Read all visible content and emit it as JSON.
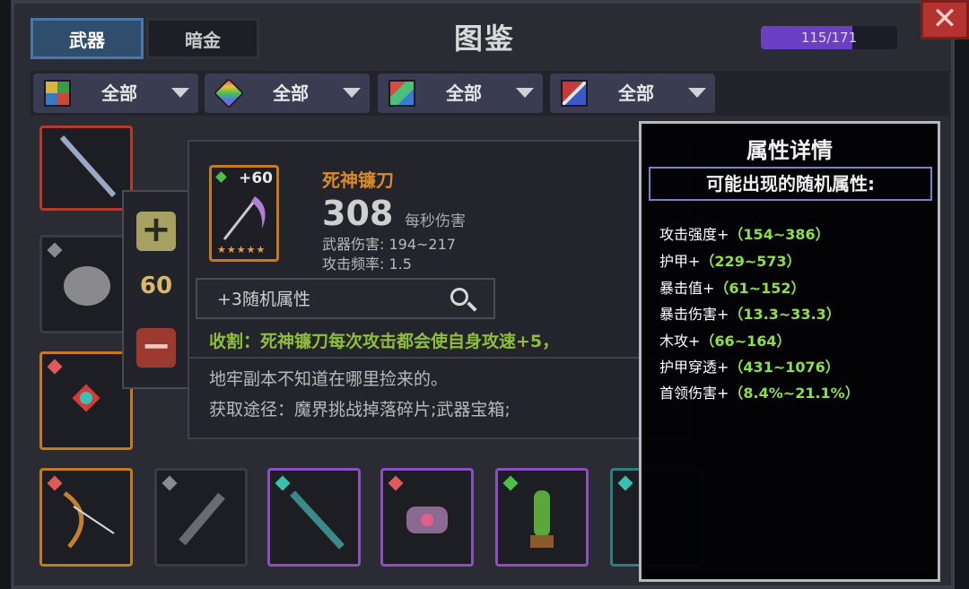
{
  "tabs": [
    {
      "label": "武器",
      "active": true
    },
    {
      "label": "暗金",
      "active": false
    }
  ],
  "title": "图鉴",
  "progress": {
    "text": "115/171",
    "fraction": 0.672
  },
  "close_icon": "close-x-icon",
  "filters": [
    {
      "label": "全部",
      "icon": "quality-grid-icon"
    },
    {
      "label": "全部",
      "icon": "element-gem-icon"
    },
    {
      "label": "全部",
      "icon": "type-color-icon"
    },
    {
      "label": "全部",
      "icon": "class-slash-icon"
    }
  ],
  "stepper": {
    "value": "60",
    "plus_icon": "plus-icon",
    "minus_icon": "minus-icon"
  },
  "item": {
    "name": "死神镰刀",
    "level": "+60",
    "stars": "★★★★★",
    "dps": "308",
    "dps_label": "每秒伤害",
    "damage": "武器伤害: 194~217",
    "attack_rate": "攻击频率: 1.5",
    "random_attrs": "+3随机属性",
    "effect": "收割：死神镰刀每次攻击都会使自身攻速+5，",
    "lore": "地牢副本不知道在哪里捡来的。",
    "source": "获取途径：魔界挑战掉落碎片;武器宝箱;"
  },
  "attr_details": {
    "title": "属性详情",
    "subtitle": "可能出现的随机属性:",
    "rows": [
      {
        "name": "攻击强度+",
        "range": "（154~386）"
      },
      {
        "name": "护甲+",
        "range": "（229~573）"
      },
      {
        "name": "暴击值+",
        "range": "（61~152）"
      },
      {
        "name": "暴击伤害+",
        "range": "（13.3~33.3）"
      },
      {
        "name": "木攻+",
        "range": "（66~164）"
      },
      {
        "name": "护甲穿透+",
        "range": "（431~1076）"
      },
      {
        "name": "首领伤害+",
        "range": "（8.4%~21.1%）"
      }
    ]
  },
  "colors": {
    "accent_blue": "#4a77a8",
    "legendary_orange": "#c47a1f",
    "attr_green": "#8ee04a",
    "effect_green": "#8fbf3a",
    "progress_purple": "#6a3fc4"
  }
}
